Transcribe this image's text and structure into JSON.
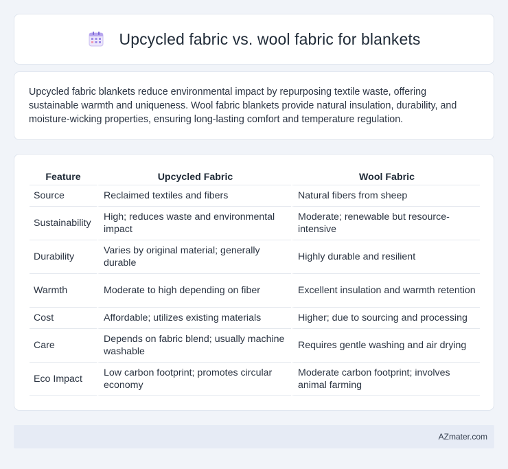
{
  "page": {
    "title": "Upcycled fabric vs. wool fabric for blankets",
    "title_icon": "calendar-icon",
    "intro": "Upcycled fabric blankets reduce environmental impact by repurposing textile waste, offering sustainable warmth and uniqueness. Wool fabric blankets provide natural insulation, durability, and moisture-wicking properties, ensuring long-lasting comfort and temperature regulation."
  },
  "table": {
    "headers": [
      "Feature",
      "Upcycled Fabric",
      "Wool Fabric"
    ],
    "rows": [
      [
        "Source",
        "Reclaimed textiles and fibers",
        "Natural fibers from sheep"
      ],
      [
        "Sustainability",
        "High; reduces waste and environmental impact",
        "Moderate; renewable but resource-intensive"
      ],
      [
        "Durability",
        "Varies by original material; generally durable",
        "Highly durable and resilient"
      ],
      [
        "Warmth",
        "Moderate to high depending on fiber",
        "Excellent insulation and warmth retention"
      ],
      [
        "Cost",
        "Affordable; utilizes existing materials",
        "Higher; due to sourcing and processing"
      ],
      [
        "Care",
        "Depends on fabric blend; usually machine washable",
        "Requires gentle washing and air drying"
      ],
      [
        "Eco Impact",
        "Low carbon footprint; promotes circular economy",
        "Moderate carbon footprint; involves animal farming"
      ]
    ]
  },
  "footer": {
    "brand": "AZmater.com"
  }
}
